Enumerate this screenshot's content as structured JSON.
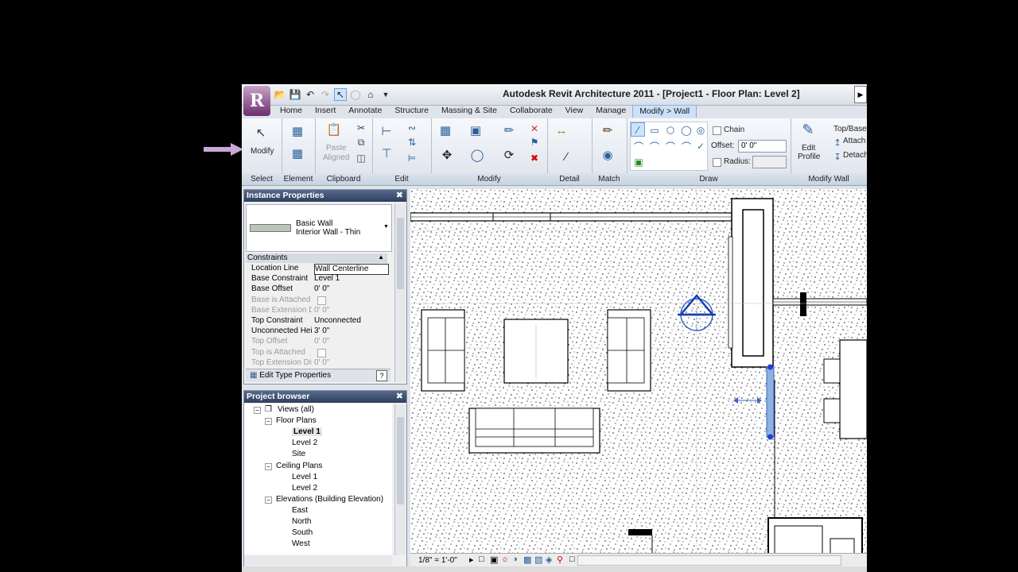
{
  "app_title": "Autodesk Revit Architecture 2011 - [Project1 - Floor Plan: Level 2]",
  "app_logo": "R",
  "tabs": [
    "Home",
    "Insert",
    "Annotate",
    "Structure",
    "Massing & Site",
    "Collaborate",
    "View",
    "Manage",
    "Modify > Wall"
  ],
  "active_tab": "Modify > Wall",
  "ribbon": {
    "select": {
      "label": "Select",
      "modify": "Modify"
    },
    "element": {
      "label": "Element"
    },
    "clipboard": {
      "label": "Clipboard",
      "paste": "Paste",
      "aligned": "Aligned"
    },
    "edit": {
      "label": "Edit"
    },
    "modify": {
      "label": "Modify"
    },
    "detail": {
      "label": "Detail"
    },
    "match": {
      "label": "Match"
    },
    "draw": {
      "label": "Draw",
      "chain": "Chain",
      "offset_label": "Offset:",
      "offset_value": "0' 0\"",
      "radius_label": "Radius:",
      "radius_value": ""
    },
    "modify_wall": {
      "label": "Modify Wall",
      "edit": "Edit",
      "profile": "Profile",
      "topbase": "Top/Base",
      "attach": "Attach",
      "detach": "Detach"
    }
  },
  "instance_properties": {
    "title": "Instance Properties",
    "type_family": "Basic Wall",
    "type_name": "Interior Wall - Thin",
    "group": "Constraints",
    "rows": [
      {
        "key": "Location Line",
        "value": "Wall Centerline",
        "dim": false
      },
      {
        "key": "Base Constraint",
        "value": "Level 1",
        "dim": false
      },
      {
        "key": "Base Offset",
        "value": "0'  0\"",
        "dim": false
      },
      {
        "key": "Base is Attached",
        "value": "",
        "dim": true
      },
      {
        "key": "Base Extension Di",
        "value": "0'  0\"",
        "dim": true
      },
      {
        "key": "Top Constraint",
        "value": "Unconnected",
        "dim": false
      },
      {
        "key": "Unconnected Hei",
        "value": "3'  0\"",
        "dim": false
      },
      {
        "key": "Top Offset",
        "value": "0'  0\"",
        "dim": true
      },
      {
        "key": "Top is Attached",
        "value": "",
        "dim": true
      },
      {
        "key": "Top Extension Dis",
        "value": "0'  0\"",
        "dim": true
      }
    ],
    "edit_type": "Edit Type Properties",
    "help": "?"
  },
  "project_browser": {
    "title": "Project browser",
    "items": [
      {
        "text": "Views (all)",
        "level": 0,
        "toggle": "−",
        "bold": false
      },
      {
        "text": "Floor Plans",
        "level": 1,
        "toggle": "−",
        "bold": false
      },
      {
        "text": "Level 1",
        "level": 2,
        "toggle": "",
        "bold": true
      },
      {
        "text": "Level 2",
        "level": 2,
        "toggle": "",
        "bold": false
      },
      {
        "text": "Site",
        "level": 2,
        "toggle": "",
        "bold": false
      },
      {
        "text": "Ceiling Plans",
        "level": 1,
        "toggle": "−",
        "bold": false
      },
      {
        "text": "Level 1",
        "level": 2,
        "toggle": "",
        "bold": false
      },
      {
        "text": "Level 2",
        "level": 2,
        "toggle": "",
        "bold": false
      },
      {
        "text": "Elevations (Building Elevation)",
        "level": 1,
        "toggle": "−",
        "bold": false
      },
      {
        "text": "East",
        "level": 2,
        "toggle": "",
        "bold": false
      },
      {
        "text": "North",
        "level": 2,
        "toggle": "",
        "bold": false
      },
      {
        "text": "South",
        "level": 2,
        "toggle": "",
        "bold": false
      },
      {
        "text": "West",
        "level": 2,
        "toggle": "",
        "bold": false
      }
    ]
  },
  "status": {
    "scale": "1/8\" = 1'-0\""
  },
  "colors": {
    "accent": "#2e3f5e",
    "selection": "#3a66c4",
    "pointer_arrow": "#c8a8d8"
  }
}
